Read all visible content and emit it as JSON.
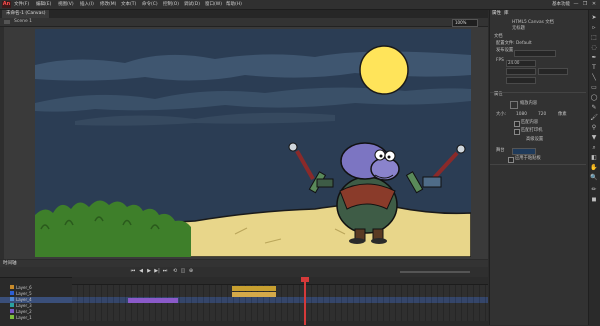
{
  "app": {
    "logo": "An",
    "menus": [
      "文件(F)",
      "编辑(E)",
      "视图(V)",
      "插入(I)",
      "修改(M)",
      "文本(T)",
      "命令(C)",
      "控制(O)",
      "调试(D)",
      "窗口(W)",
      "帮助(H)"
    ],
    "right_title": "基本功能",
    "window_buttons": [
      "—",
      "❐",
      "✕"
    ]
  },
  "document": {
    "tab_label": "未命名-1 (Canvas)",
    "scene_label": "Scene 1",
    "zoom": "100%"
  },
  "properties_panel": {
    "tabs": [
      "属性",
      "库"
    ],
    "doc_type": "HTML5 Canvas 文档",
    "doc_name": "无标题",
    "section_doc": "文档",
    "publish_label": "发布设置...",
    "profile_label": "配置文件:",
    "profile_value": "Default",
    "target_label": "发布设置",
    "fps_label": "FPS",
    "fps_value": "24.00",
    "size_label": "大小:",
    "width_value": "1080",
    "height_value": "720",
    "units": "像素",
    "section_props": "属性",
    "scale_label": "缩放内容",
    "advanced_label": "高级设置",
    "stage_label": "舞台",
    "stage_color": "#1f3a5a",
    "apply_label": "应用于粘贴板",
    "checkbox_a": "匹配内容",
    "checkbox_b": "匹配打印机"
  },
  "timeline": {
    "title": "时间轴",
    "layers": [
      {
        "name": "Layer_6",
        "color": "#c78a2a"
      },
      {
        "name": "Layer_5",
        "color": "#2d5fd4"
      },
      {
        "name": "Layer_4",
        "color": "#4f8bd4"
      },
      {
        "name": "Layer_3",
        "color": "#2aa0a0"
      },
      {
        "name": "Layer_2",
        "color": "#7c58c9"
      },
      {
        "name": "Layer_1",
        "color": "#7dbd3d"
      }
    ],
    "controls": [
      "⏮",
      "◀",
      "▶",
      "▶|",
      "⏭",
      "⟲",
      "◫",
      "⊕"
    ],
    "playhead_frame": 63
  },
  "colors": {
    "sky": "#2b3d54",
    "sand": "#e8d68a",
    "moon": "#ffe45a",
    "playhead": "#d63a3a"
  }
}
